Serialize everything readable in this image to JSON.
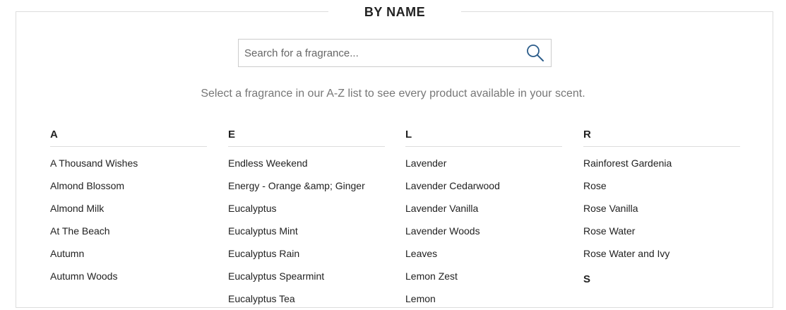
{
  "section": {
    "title": "BY NAME"
  },
  "search": {
    "placeholder": "Search for a fragrance..."
  },
  "intro_text": "Select a fragrance in our A-Z list to see every product available in your scent.",
  "columns": [
    {
      "letter": "A",
      "items": [
        "A Thousand Wishes",
        "Almond Blossom",
        "Almond Milk",
        "At The Beach",
        "Autumn",
        "Autumn Woods"
      ]
    },
    {
      "letter": "E",
      "items": [
        "Endless Weekend",
        "Energy - Orange &amp; Ginger",
        "Eucalyptus",
        "Eucalyptus Mint",
        "Eucalyptus Rain",
        "Eucalyptus Spearmint",
        "Eucalyptus Tea"
      ]
    },
    {
      "letter": "L",
      "items": [
        "Lavender",
        "Lavender Cedarwood",
        "Lavender Vanilla",
        "Lavender Woods",
        "Leaves",
        "Lemon Zest",
        "Lemon"
      ]
    },
    {
      "letter": "R",
      "items": [
        "Rainforest Gardenia",
        "Rose",
        "Rose Vanilla",
        "Rose Water",
        "Rose Water and Ivy"
      ],
      "next_letter": "S"
    }
  ],
  "icons": {
    "search": "search-icon"
  },
  "colors": {
    "border": "#dddddd",
    "text": "#222222",
    "muted": "#777777"
  }
}
